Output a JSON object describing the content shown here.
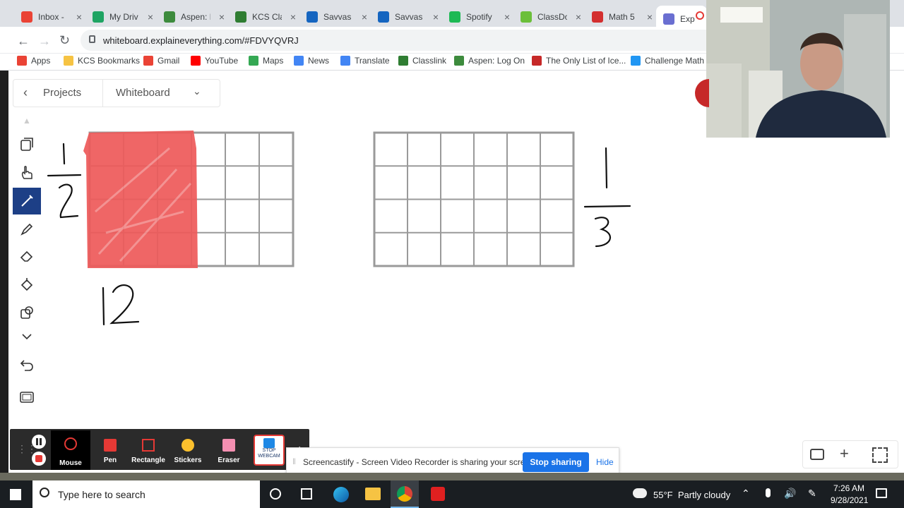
{
  "browser": {
    "tabs": [
      {
        "label": "Inbox -",
        "icon": "gmail-icon"
      },
      {
        "label": "My Driv",
        "icon": "drive-icon"
      },
      {
        "label": "Aspen: P",
        "icon": "aspen-icon"
      },
      {
        "label": "KCS Clas",
        "icon": "classlink-icon"
      },
      {
        "label": "Savvas E",
        "icon": "savvas-icon"
      },
      {
        "label": "Savvas F",
        "icon": "savvas-icon"
      },
      {
        "label": "Spotify",
        "icon": "spotify-icon"
      },
      {
        "label": "ClassDo",
        "icon": "classdojo-icon"
      },
      {
        "label": "Math 5",
        "icon": "math-icon"
      },
      {
        "label": "Exp",
        "icon": "explain-everything-icon",
        "active": true
      }
    ],
    "url": "whiteboard.explaineverything.com/#FDVYQVRJ",
    "bookmarks": [
      {
        "label": "Apps",
        "icon": "apps-grid-icon"
      },
      {
        "label": "KCS Bookmarks",
        "icon": "folder-icon"
      },
      {
        "label": "Gmail",
        "icon": "gmail-icon"
      },
      {
        "label": "YouTube",
        "icon": "youtube-icon"
      },
      {
        "label": "Maps",
        "icon": "maps-icon"
      },
      {
        "label": "News",
        "icon": "news-icon"
      },
      {
        "label": "Translate",
        "icon": "translate-icon"
      },
      {
        "label": "Classlink",
        "icon": "classlink-icon"
      },
      {
        "label": "Aspen: Log On",
        "icon": "aspen-icon"
      },
      {
        "label": "The Only List of Ice...",
        "icon": "list-icon"
      },
      {
        "label": "Challenge Math",
        "icon": "weebly-icon"
      }
    ]
  },
  "app": {
    "back_label": "Projects",
    "project_title": "Whiteboard",
    "tools": [
      {
        "name": "duplicate-icon"
      },
      {
        "name": "hand-icon"
      },
      {
        "name": "pen-icon",
        "selected": true
      },
      {
        "name": "highlighter-icon"
      },
      {
        "name": "eraser-icon"
      },
      {
        "name": "fill-icon"
      },
      {
        "name": "shapes-icon"
      },
      {
        "name": "chevron-down-icon"
      },
      {
        "name": "undo-icon"
      },
      {
        "name": "frame-icon"
      }
    ],
    "accent_color": "#1d3f86",
    "ink_color": "#000000",
    "shade_color": "#ee5a5a"
  },
  "board": {
    "fraction_left": {
      "numerator": "1",
      "denominator": "2"
    },
    "fraction_right": {
      "numerator": "1",
      "denominator": "3"
    },
    "count_label": "12",
    "grid_left": {
      "rows": 4,
      "cols": 6,
      "shaded_cols": 3
    },
    "grid_right": {
      "rows": 4,
      "cols": 6,
      "shaded_cols": 0
    }
  },
  "screencastify": {
    "tools": [
      "Mouse",
      "Pen",
      "Rectangle",
      "Stickers",
      "Eraser"
    ],
    "webcam_button": "STOP WEBCAM",
    "share_message": "Screencastify - Screen Video Recorder is sharing your screen.",
    "stop_sharing": "Stop sharing",
    "hide": "Hide"
  },
  "taskbar": {
    "search_placeholder": "Type here to search",
    "weather": "55°F  Partly cloudy",
    "time": "7:26 AM",
    "date": "9/28/2021"
  }
}
